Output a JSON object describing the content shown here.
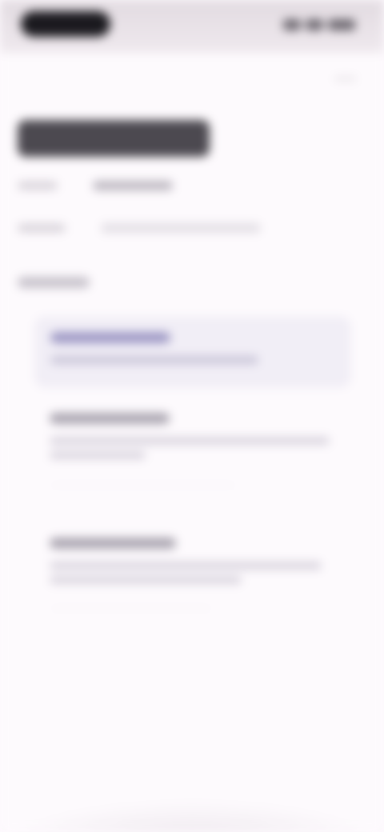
{
  "status_bar": {
    "time": "",
    "icons": [
      "wifi-icon",
      "signal-icon",
      "battery-icon"
    ]
  },
  "header": {
    "title": "",
    "more_icon": "more-vert-icon"
  },
  "details": {
    "version_label": "",
    "version_value": "",
    "updated_label": "",
    "updated_value": ""
  },
  "section": {
    "title": ""
  },
  "options": [
    {
      "title": "",
      "description": "",
      "selected": true
    },
    {
      "title": "",
      "description": "",
      "selected": false
    },
    {
      "title": "",
      "description": "",
      "selected": false
    }
  ],
  "colors": {
    "background": "#fdfafd",
    "status_bar": "#e2dbe1",
    "accent": "#9c97c4",
    "selected_bg": "#f1eef6"
  }
}
